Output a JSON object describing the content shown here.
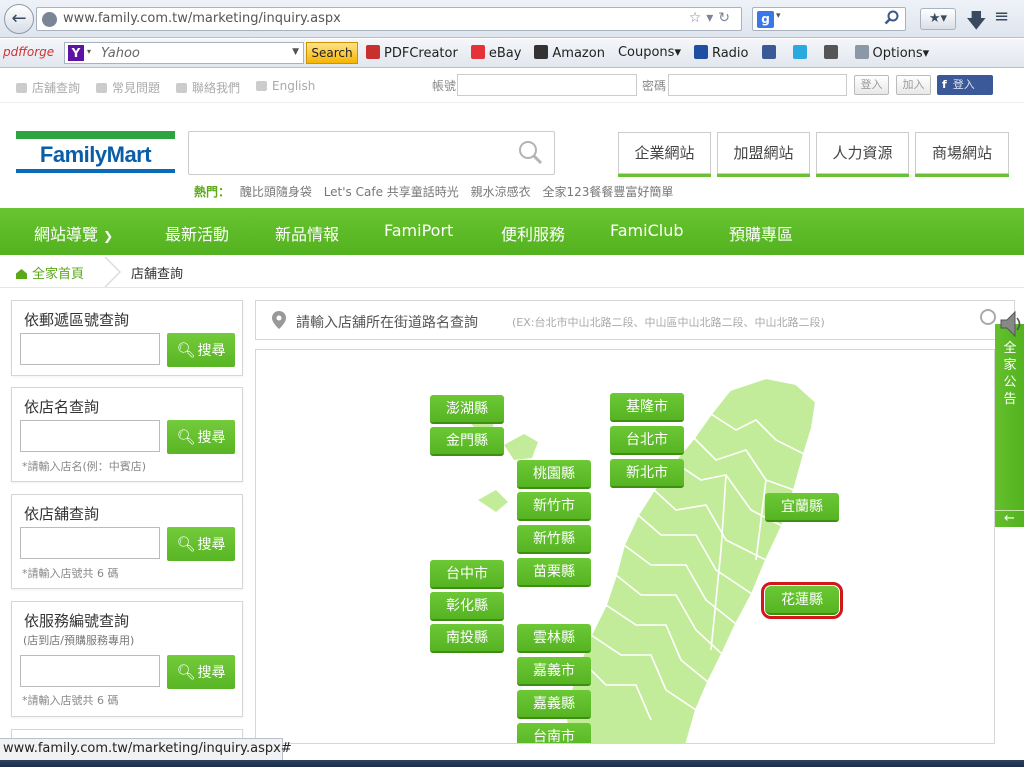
{
  "browser": {
    "url": "www.family.com.tw/marketing/inquiry.aspx",
    "search_engine_icon": "google-icon",
    "toolbar": {
      "pdfforge_label": "pdfforge",
      "yahoo_text": "Yahoo",
      "search_label": "Search",
      "items": [
        {
          "label": "PDFCreator",
          "icon": "pdf-icon",
          "color": "#c8302e"
        },
        {
          "label": "eBay",
          "icon": "ebay-icon",
          "color": "#e53238"
        },
        {
          "label": "Amazon",
          "icon": "amazon-icon",
          "color": "#333333"
        },
        {
          "label": "Coupons▾",
          "icon": "",
          "color": ""
        },
        {
          "label": "Radio",
          "icon": "radio-icon",
          "color": "#1e4fa3"
        },
        {
          "label": "",
          "icon": "facebook-icon",
          "color": "#3b5998"
        },
        {
          "label": "",
          "icon": "twitter-icon",
          "color": "#2aa9e0"
        },
        {
          "label": "",
          "icon": "googleplus-icon",
          "color": "#555555"
        },
        {
          "label": "Options▾",
          "icon": "gear-icon",
          "color": "#8a98a8"
        }
      ]
    },
    "status_text": "www.family.com.tw/marketing/inquiry.aspx#"
  },
  "util": {
    "links": [
      "店舖查詢",
      "常見問題",
      "聯絡我們",
      "English"
    ],
    "account_label": "帳號",
    "password_label": "密碼",
    "login_label": "登入",
    "join_label": "加入",
    "fb_login_label": "登入"
  },
  "header": {
    "logo_text": "FamilyMart",
    "hot_label": "熱門：",
    "hot_items": [
      "醜比頭隨身袋",
      "Let's Cafe 共享童話時光",
      "親水涼感衣",
      "全家123餐餐豐富好簡單"
    ],
    "buttons": [
      "企業網站",
      "加盟網站",
      "人力資源",
      "商場網站"
    ]
  },
  "nav": {
    "items": [
      "網站導覽",
      "最新活動",
      "新品情報",
      "FamiPort",
      "便利服務",
      "FamiClub",
      "預購專區"
    ]
  },
  "breadcrumb": {
    "home": "全家首頁",
    "current": "店舖查詢"
  },
  "panels": {
    "postal": {
      "title": "依郵遞區號查詢",
      "button": "搜尋"
    },
    "name": {
      "title": "依店名查詢",
      "button": "搜尋",
      "hint": "*請輸入店名(例：中賓店)"
    },
    "store": {
      "title": "依店舖查詢",
      "button": "搜尋",
      "hint": "*請輸入店號共 6 碼"
    },
    "service": {
      "title": "依服務編號查詢",
      "subtitle": "(店到店/預購服務專用)",
      "button": "搜尋",
      "hint": "*請輸入店號共 6 碼"
    }
  },
  "map": {
    "street_label": "請輸入店舖所在街道路名查詢",
    "street_example": "(EX:台北市中山北路二段、中山區中山北路二段、中山北路二段)",
    "counties": [
      "澎湖縣",
      "金門縣",
      "基隆市",
      "台北市",
      "新北市",
      "桃園縣",
      "新竹市",
      "新竹縣",
      "苗栗縣",
      "宜蘭縣",
      "台中市",
      "彰化縣",
      "南投縣",
      "雲林縣",
      "嘉義市",
      "嘉義縣",
      "台南市",
      "花蓮縣"
    ],
    "selected": "花蓮縣"
  },
  "side_tab": {
    "label": "全家公告",
    "arrow": "←"
  },
  "colors": {
    "brand_green": "#5db827",
    "brand_blue": "#0a5ea8",
    "map_fill": "#c3ec9a",
    "highlight_red": "#d2161b"
  }
}
